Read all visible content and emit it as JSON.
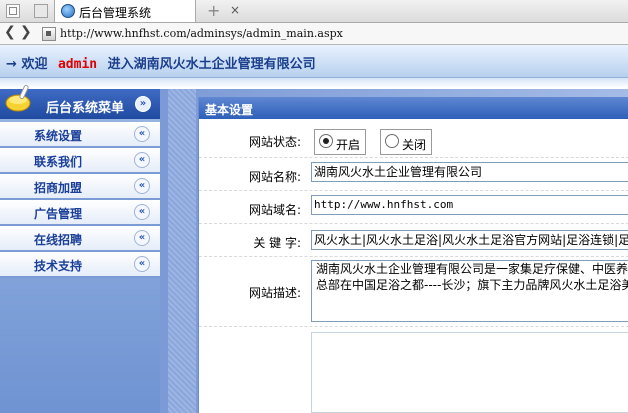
{
  "browser": {
    "tab_title": "后台管理系统",
    "tab_close": "×",
    "new_tab": "+",
    "url": "http://www.hnfhst.com/adminsys/admin_main.aspx",
    "back_icon": "chevron-left-icon",
    "forward_icon": "chevron-right-icon",
    "favicon": "globe-icon"
  },
  "banner": {
    "arrow": "→",
    "prefix": "欢迎",
    "user": "admin",
    "suffix": "进入湖南风火水土企业管理有限公司"
  },
  "sidebar": {
    "title": "后台系统菜单",
    "toggle_glyph": "»",
    "items": [
      {
        "label": "系统设置",
        "glyph": "«"
      },
      {
        "label": "联系我们",
        "glyph": "«"
      },
      {
        "label": "招商加盟",
        "glyph": "«"
      },
      {
        "label": "广告管理",
        "glyph": "«"
      },
      {
        "label": "在线招聘",
        "glyph": "«"
      },
      {
        "label": "技术支持",
        "glyph": "«"
      }
    ]
  },
  "panel": {
    "title": "基本设置",
    "status_label": "网站状态:",
    "status_on": "开启",
    "status_off": "关闭",
    "status_selected": "开启",
    "name_label": "网站名称:",
    "name_value": "湖南风火水土企业管理有限公司",
    "domain_label": "网站域名:",
    "domain_value": "http://www.hnfhst.com",
    "keywords_label": "关 键 字:",
    "keywords_value": "风火水土|风火水土足浴|风火水土足浴官方网站|足浴连锁|足",
    "desc_label": "网站描述:",
    "desc_line1": "湖南风火水土企业管理有限公司是一家集足疗保健、中医养",
    "desc_line2": "总部在中国足浴之都----长沙；旗下主力品牌风火水土足浴美"
  },
  "colors": {
    "banner_text": "#1b3f8c",
    "banner_user": "#e00000",
    "menu_header": "#1f4aa0",
    "menu_label": "#1a3f9a",
    "panel_title": "#2e5fb8"
  }
}
